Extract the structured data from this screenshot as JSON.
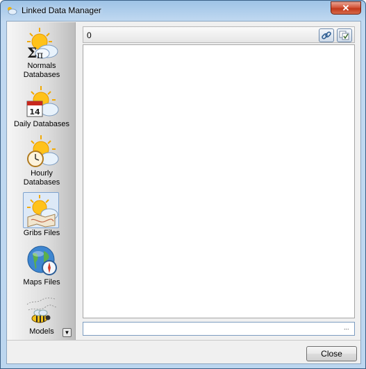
{
  "window": {
    "title": "Linked Data Manager",
    "close_glyph": "✕"
  },
  "nav": {
    "items": [
      {
        "label_line1": "Normals",
        "label_line2": "Databases",
        "icon": "sigma-pi-cloud-icon",
        "selected": false
      },
      {
        "label_line1": "Daily Databases",
        "label_line2": "",
        "icon": "calendar-cloud-icon",
        "calendar_day": "14",
        "selected": false
      },
      {
        "label_line1": "Hourly",
        "label_line2": "Databases",
        "icon": "clock-cloud-icon",
        "selected": false
      },
      {
        "label_line1": "Gribs Files",
        "label_line2": "",
        "icon": "grib-map-cloud-icon",
        "selected": true
      },
      {
        "label_line1": "Maps Files",
        "label_line2": "",
        "icon": "globe-compass-icon",
        "selected": false
      },
      {
        "label_line1": "Models",
        "label_line2": "",
        "icon": "bee-formula-icon",
        "selected": false
      }
    ],
    "scroll_glyph": "▼"
  },
  "main": {
    "count": "0",
    "link_button_icon": "link-icon",
    "check_button_icon": "checklist-icon",
    "path_value": "",
    "browse_label": "..."
  },
  "footer": {
    "close_label": "Close"
  },
  "colors": {
    "title_gradient": "#9ec3e6",
    "close_red": "#c2381b",
    "selection_bg": "#dde9f7",
    "field_border": "#7c9cc0"
  }
}
